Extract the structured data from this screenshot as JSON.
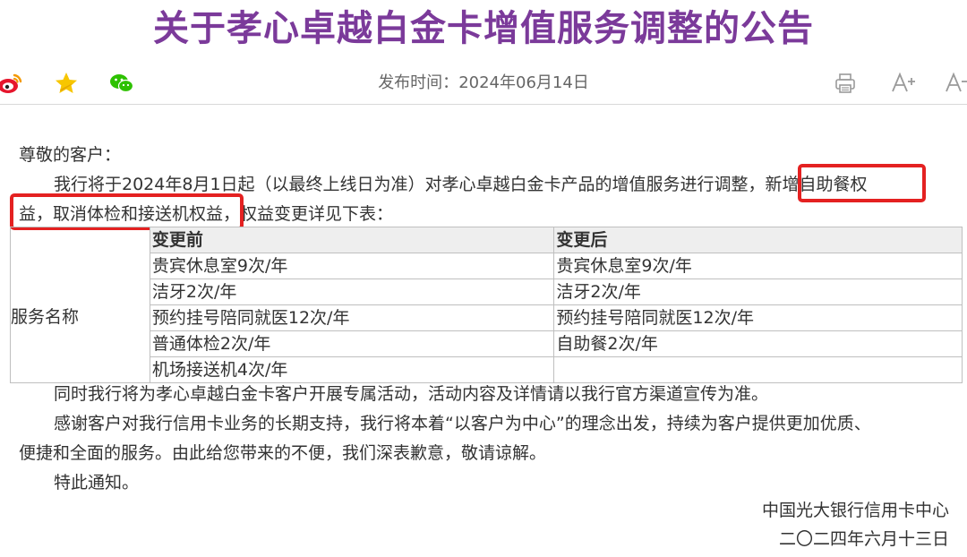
{
  "title": "关于孝心卓越白金卡增值服务调整的公告",
  "toolbar": {
    "share_icons": [
      "weibo-icon",
      "qzone-star-icon",
      "wechat-icon"
    ],
    "publish_label": "发布时间：",
    "publish_date": "2024年06月14日",
    "tool_icons": [
      "print-icon",
      "font-increase-icon",
      "font-decrease-icon"
    ]
  },
  "article": {
    "greeting": "尊敬的客户：",
    "para1_part1": "我行将于2024年8月1日起（以最终上线日为准）对孝心卓越白金卡产品的增值服务进行调整，",
    "para1_highlight1": "新增自助餐权",
    "para1_highlight2_start": "益，取消体检和接送机权益",
    "para1_part2": "，权益变更详见下表：",
    "table": {
      "header_before": "变更前",
      "header_after": "变更后",
      "row_label": "服务名称",
      "rows": [
        {
          "before": "贵宾休息室9次/年",
          "after": "贵宾休息室9次/年"
        },
        {
          "before": "洁牙2次/年",
          "after": "洁牙2次/年"
        },
        {
          "before": "预约挂号陪同就医12次/年",
          "after": "预约挂号陪同就医12次/年"
        },
        {
          "before": "普通体检2次/年",
          "after": "自助餐2次/年"
        },
        {
          "before": "机场接送机4次/年",
          "after": ""
        }
      ]
    },
    "para2": "同时我行将为孝心卓越白金卡客户开展专属活动，活动内容及详情请以我行官方渠道宣传为准。",
    "para3_line1": "感谢客户对我行信用卡业务的长期支持，我行将本着“以客户为中心”的理念出发，持续为客户提供更加优质、",
    "para3_line2": "便捷和全面的服务。由此给您带来的不便，我们深表歉意，敬请谅解。",
    "closing": "特此通知。",
    "signature_org": "中国光大银行信用卡中心",
    "signature_date": "二〇二四年六月十三日"
  },
  "colors": {
    "title": "#7b3a9a",
    "highlight_border": "#e42121",
    "table_header_bg": "#eeeeee",
    "weibo_red": "#e6162d",
    "star_yellow": "#f7c600",
    "wechat_green": "#2dc100"
  }
}
